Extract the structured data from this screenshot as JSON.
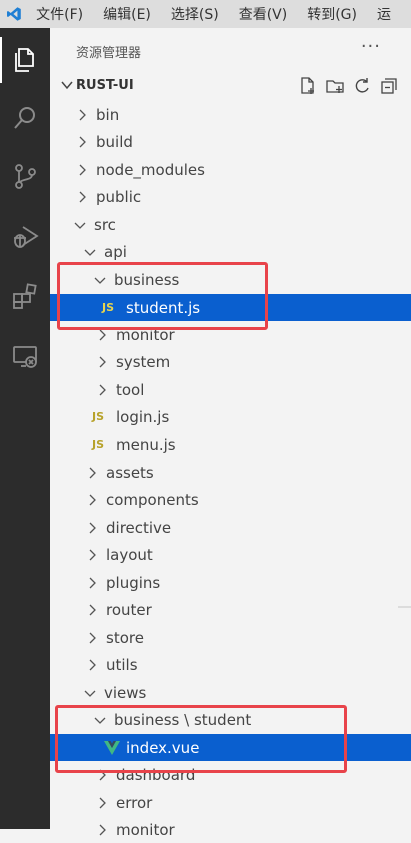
{
  "menubar": {
    "items": [
      "文件(F)",
      "编辑(E)",
      "选择(S)",
      "查看(V)",
      "转到(G)",
      "运"
    ]
  },
  "activitybar": {
    "icons": [
      "explorer-icon",
      "search-icon",
      "source-control-icon",
      "run-debug-icon",
      "extensions-icon",
      "remote-explorer-icon"
    ]
  },
  "explorer": {
    "title": "资源管理器",
    "more": "···",
    "section": "RUST-UI"
  },
  "tree": {
    "bin": "bin",
    "build": "build",
    "node_modules": "node_modules",
    "public": "public",
    "src": "src",
    "api": "api",
    "business": "business",
    "student_js": "student.js",
    "monitor": "monitor",
    "system": "system",
    "tool": "tool",
    "login_js": "login.js",
    "menu_js": "menu.js",
    "assets": "assets",
    "components": "components",
    "directive": "directive",
    "layout": "layout",
    "plugins": "plugins",
    "router": "router",
    "store": "store",
    "utils": "utils",
    "views": "views",
    "business_student": "business \\ student",
    "index_vue": "index.vue",
    "dashboard": "dashboard",
    "error": "error",
    "monitor2": "monitor"
  },
  "file_badge": "JS",
  "colors": {
    "selection": "#0a5fcf",
    "annotation": "#e8434a",
    "activitybar": "#2c2c2c",
    "js_badge": "#b7a22a",
    "vue": "#41b883"
  }
}
